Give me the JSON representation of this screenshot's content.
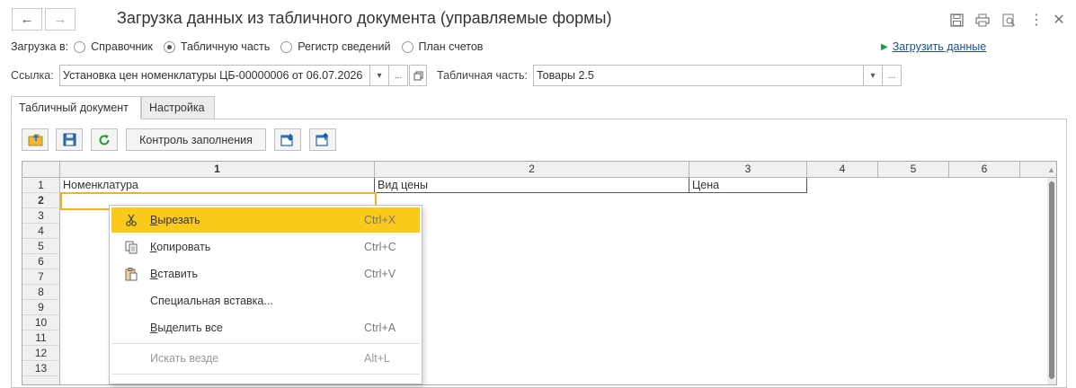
{
  "window": {
    "title": "Загрузка данных из табличного документа (управляемые формы)"
  },
  "load_into": {
    "label": "Загрузка в:",
    "options": [
      "Справочник",
      "Табличную часть",
      "Регистр сведений",
      "План счетов"
    ],
    "selected_index": 1
  },
  "load_link": "Загрузить данные",
  "ref": {
    "label": "Ссылка:",
    "value": "Установка цен номенклатуры ЦБ-00000006 от 06.07.2026",
    "dots": "..."
  },
  "table_part": {
    "label": "Табличная часть:",
    "value": "Товары 2.5",
    "dots": "..."
  },
  "tabs": [
    {
      "label": "Табличный документ",
      "active": true
    },
    {
      "label": "Настройка",
      "active": false
    }
  ],
  "toolbar": {
    "check_label": "Контроль заполнения"
  },
  "grid": {
    "col_headers": [
      "1",
      "2",
      "3",
      "4",
      "5",
      "6"
    ],
    "row_headers": [
      "1",
      "2",
      "3",
      "4",
      "5",
      "6",
      "7",
      "8",
      "9",
      "10",
      "11",
      "12",
      "13"
    ],
    "row1": [
      "Номенклатура",
      "Вид цены",
      "Цена"
    ]
  },
  "context_menu": {
    "items": [
      {
        "label": "Вырезать",
        "shortcut": "Ctrl+X",
        "icon": "scissors-icon"
      },
      {
        "label": "Копировать",
        "shortcut": "Ctrl+C",
        "icon": "copy-icon"
      },
      {
        "label": "Вставить",
        "shortcut": "Ctrl+V",
        "icon": "paste-icon"
      },
      {
        "label": "Специальная вставка...",
        "shortcut": ""
      },
      {
        "label": "Выделить все",
        "shortcut": "Ctrl+A"
      },
      {
        "label": "Искать везде",
        "shortcut": "Alt+L"
      }
    ]
  },
  "colors": {
    "accent_green": "#1f9a3a",
    "link_blue": "#1a4fa0",
    "highlight_yellow": "#fbc91a"
  }
}
